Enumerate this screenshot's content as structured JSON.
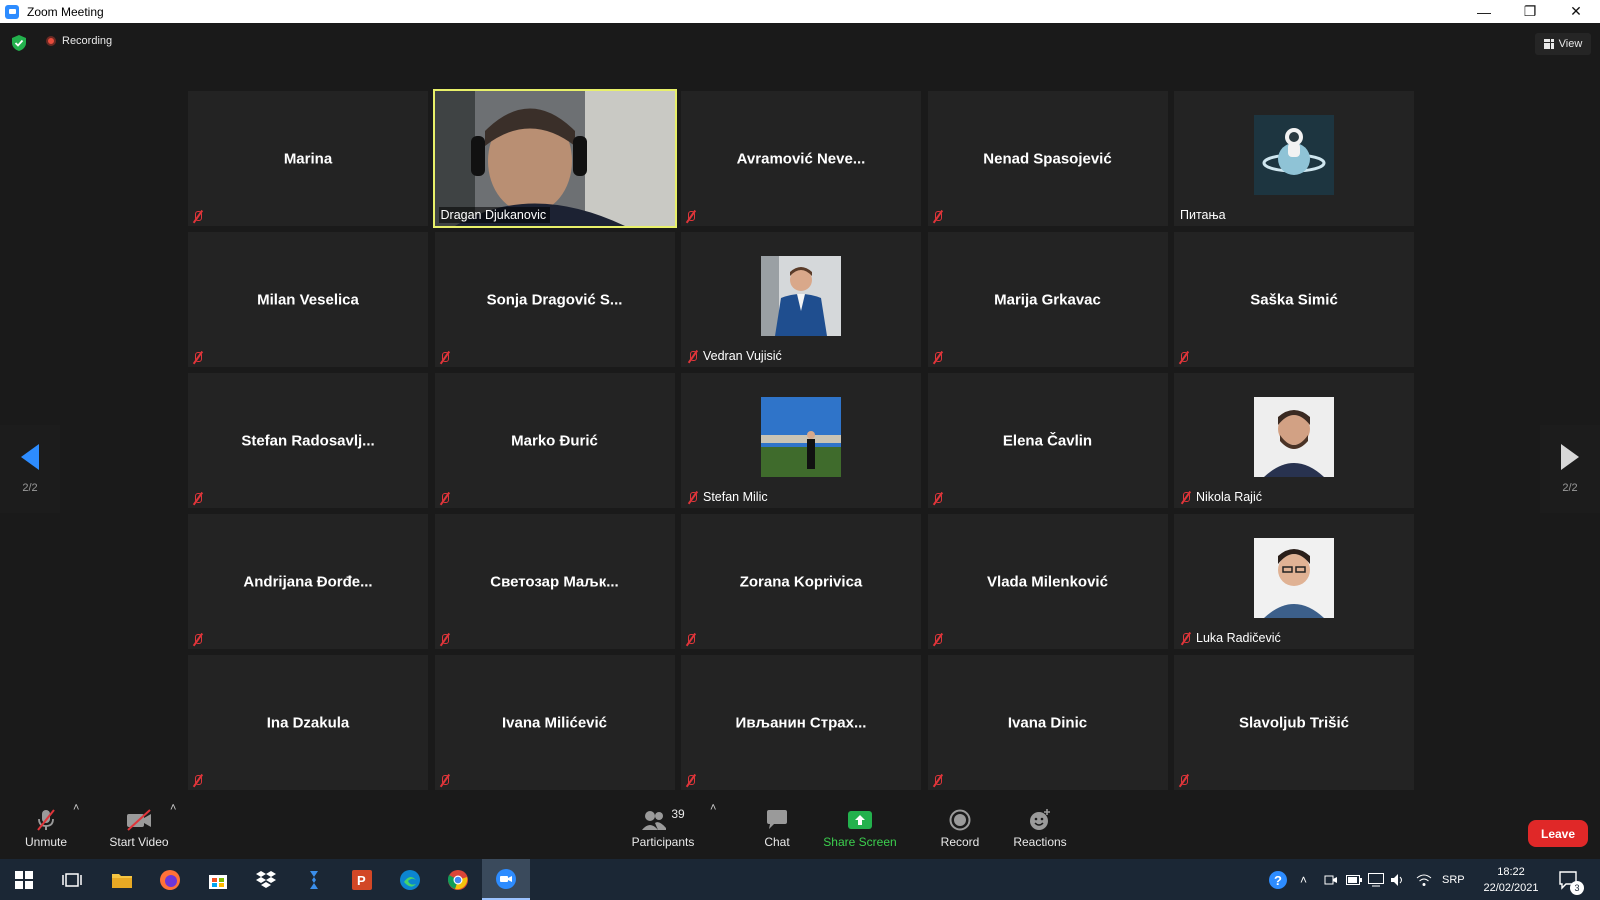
{
  "window": {
    "title": "Zoom Meeting"
  },
  "status": {
    "recording_label": "Recording"
  },
  "view_button": "View",
  "pager": {
    "prev_label": "2/2",
    "next_label": "2/2"
  },
  "tiles": [
    {
      "name": "Marina"
    },
    {
      "name": "Dragan Djukanovic",
      "active": true
    },
    {
      "name": "Avramović  Neve..."
    },
    {
      "name": "Nenad Spasojević"
    },
    {
      "name": "Питања"
    },
    {
      "name": "Milan Veselica"
    },
    {
      "name": "Sonja  Dragović  S..."
    },
    {
      "name": "Vedran Vujisić"
    },
    {
      "name": "Marija Grkavac"
    },
    {
      "name": "Saška Simić"
    },
    {
      "name": "Stefan  Radosavlj..."
    },
    {
      "name": "Marko Đurić"
    },
    {
      "name": "Stefan Milic"
    },
    {
      "name": "Elena Čavlin"
    },
    {
      "name": "Nikola Rajić"
    },
    {
      "name": "Andrijana  Đorđe..."
    },
    {
      "name": "Светозар  Мaљк..."
    },
    {
      "name": "Zorana Koprivica"
    },
    {
      "name": "Vlada Milenković"
    },
    {
      "name": "Luka Radičević"
    },
    {
      "name": "Ina Dzakula"
    },
    {
      "name": "Ivana Milićević"
    },
    {
      "name": "Ивљанин  Страх..."
    },
    {
      "name": "Ivana Dinic"
    },
    {
      "name": "Slavoljub Trišić"
    }
  ],
  "toolbar": {
    "unmute": "Unmute",
    "start_video": "Start Video",
    "participants": "Participants",
    "participants_count": "39",
    "chat": "Chat",
    "share_screen": "Share Screen",
    "record": "Record",
    "reactions": "Reactions",
    "leave": "Leave"
  },
  "taskbar": {
    "language": "SRP",
    "time": "18:22",
    "date": "22/02/2021",
    "notifications": "3"
  },
  "colors": {
    "accent": "#2d8cff",
    "active_speaker_border": "#e8f06a",
    "leave": "#e02828",
    "share": "#3ccf4e",
    "muted": "#e0353a"
  }
}
